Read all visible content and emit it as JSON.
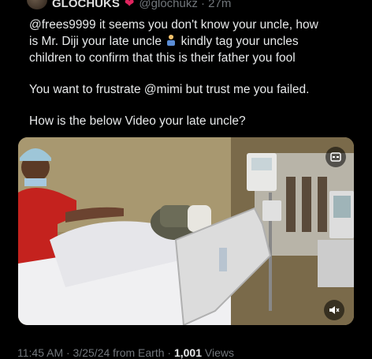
{
  "tweet": {
    "display_name": "GLOCHUKS",
    "handle_time": "@glochukz · 27m",
    "line1": "@frees9999 it seems you don't know your uncle, how",
    "line2_pre": "is Mr. Diji your late uncle ",
    "line2_post": " kindly tag your uncles",
    "line3": "children to confirm that this is their father you fool",
    "para2": "You want to frustrate @mimi but trust me you failed.",
    "para3": "How is the below Video your late uncle?",
    "footer_time": "11:45 AM · 3/25/24 from Earth · ",
    "views_count": "1,001",
    "views_label": " Views"
  },
  "icons": {
    "verified": "heart-icon",
    "emoji": "person-facepalming-icon",
    "media_top": "captions-icon",
    "media_bottom": "mute-icon"
  },
  "colors": {
    "background": "#000000",
    "heart": "#e0245e",
    "secondary_text": "#71767b"
  }
}
